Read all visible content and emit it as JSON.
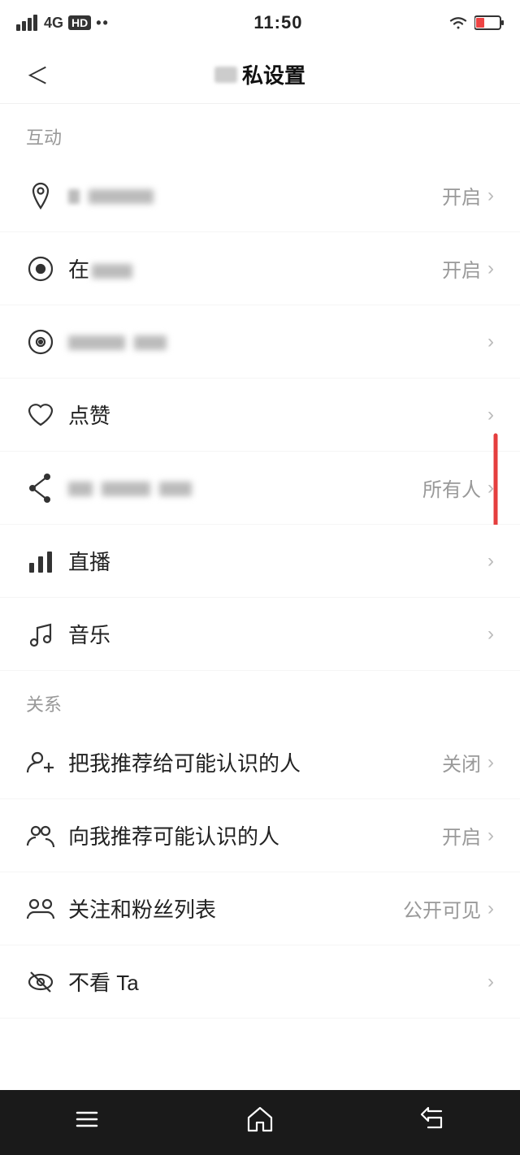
{
  "statusBar": {
    "time": "11:50",
    "signal": "4G HD",
    "leftIcons": [
      "4g-icon",
      "hd-icon",
      "dot-icon"
    ]
  },
  "header": {
    "backLabel": "<",
    "title": "私设置",
    "titleBlurText": "■"
  },
  "sections": [
    {
      "id": "interaction",
      "label": "互动",
      "items": [
        {
          "id": "location",
          "icon": "location-icon",
          "text": "位置信息",
          "blurred": true,
          "rightText": "开启",
          "hasChevron": true
        },
        {
          "id": "status",
          "icon": "circle-dot-icon",
          "text": "在线状态",
          "blurred": true,
          "rightText": "开启",
          "hasChevron": true
        },
        {
          "id": "view",
          "icon": "eye-icon",
          "text": "浏览记录",
          "blurred": true,
          "rightText": "",
          "hasChevron": true
        },
        {
          "id": "like",
          "icon": "heart-icon",
          "text": "点赞",
          "blurred": false,
          "rightText": "",
          "hasChevron": true
        },
        {
          "id": "share",
          "icon": "share-icon",
          "text": "分享权限设置",
          "blurred": true,
          "rightText": "所有人",
          "hasChevron": true,
          "hasRedArrow": false
        },
        {
          "id": "live",
          "icon": "bar-chart-icon",
          "text": "直播",
          "blurred": false,
          "rightText": "",
          "hasChevron": true
        },
        {
          "id": "music",
          "icon": "music-icon",
          "text": "音乐",
          "blurred": false,
          "rightText": "",
          "hasChevron": true
        }
      ]
    },
    {
      "id": "relationship",
      "label": "关系",
      "items": [
        {
          "id": "recommend-me",
          "icon": "person-add-icon",
          "text": "把我推荐给可能认识的人",
          "blurred": false,
          "rightText": "关闭",
          "hasChevron": true
        },
        {
          "id": "recommend-others",
          "icon": "persons-icon",
          "text": "向我推荐可能认识的人",
          "blurred": false,
          "rightText": "开启",
          "hasChevron": true
        },
        {
          "id": "follow-fans",
          "icon": "group-icon",
          "text": "关注和粉丝列表",
          "blurred": false,
          "rightText": "公开可见",
          "hasChevron": true
        },
        {
          "id": "no-see",
          "icon": "no-see-icon",
          "text": "不看 Ta",
          "blurred": false,
          "rightText": "",
          "hasChevron": true
        }
      ]
    }
  ],
  "bottomNav": {
    "items": [
      {
        "id": "menu",
        "icon": "menu-icon",
        "label": "菜单"
      },
      {
        "id": "home",
        "icon": "home-icon",
        "label": "主页"
      },
      {
        "id": "back",
        "icon": "back-icon",
        "label": "返回"
      }
    ]
  }
}
